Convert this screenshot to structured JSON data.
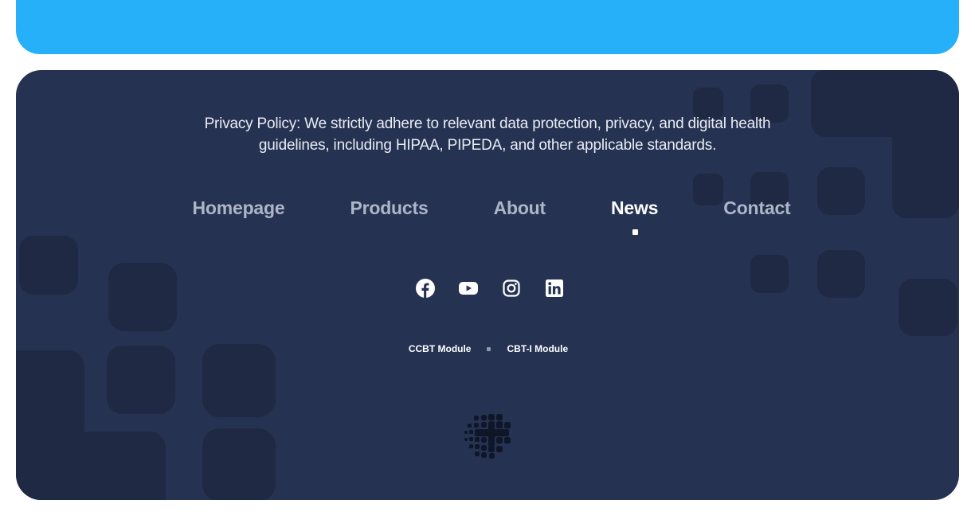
{
  "footer": {
    "privacy_text": "Privacy Policy: We strictly adhere to relevant data protection, privacy, and digital health guidelines, including HIPAA, PIPEDA, and other applicable standards.",
    "nav": [
      {
        "label": "Homepage",
        "active": false
      },
      {
        "label": "Products",
        "active": false
      },
      {
        "label": "About",
        "active": false
      },
      {
        "label": "News",
        "active": true
      },
      {
        "label": "Contact",
        "active": false
      }
    ],
    "social_icons": [
      "facebook-icon",
      "youtube-icon",
      "instagram-icon",
      "linkedin-icon"
    ],
    "modules": [
      "CCBT Module",
      "CBT-I Module"
    ],
    "logo_icon": "medical-cross-dots-logo"
  },
  "colors": {
    "banner": "#26b0fa",
    "footer_bg": "#253252",
    "tile": "#1f2944",
    "nav_inactive": "#aeb5c7",
    "nav_active": "#ffffff"
  }
}
